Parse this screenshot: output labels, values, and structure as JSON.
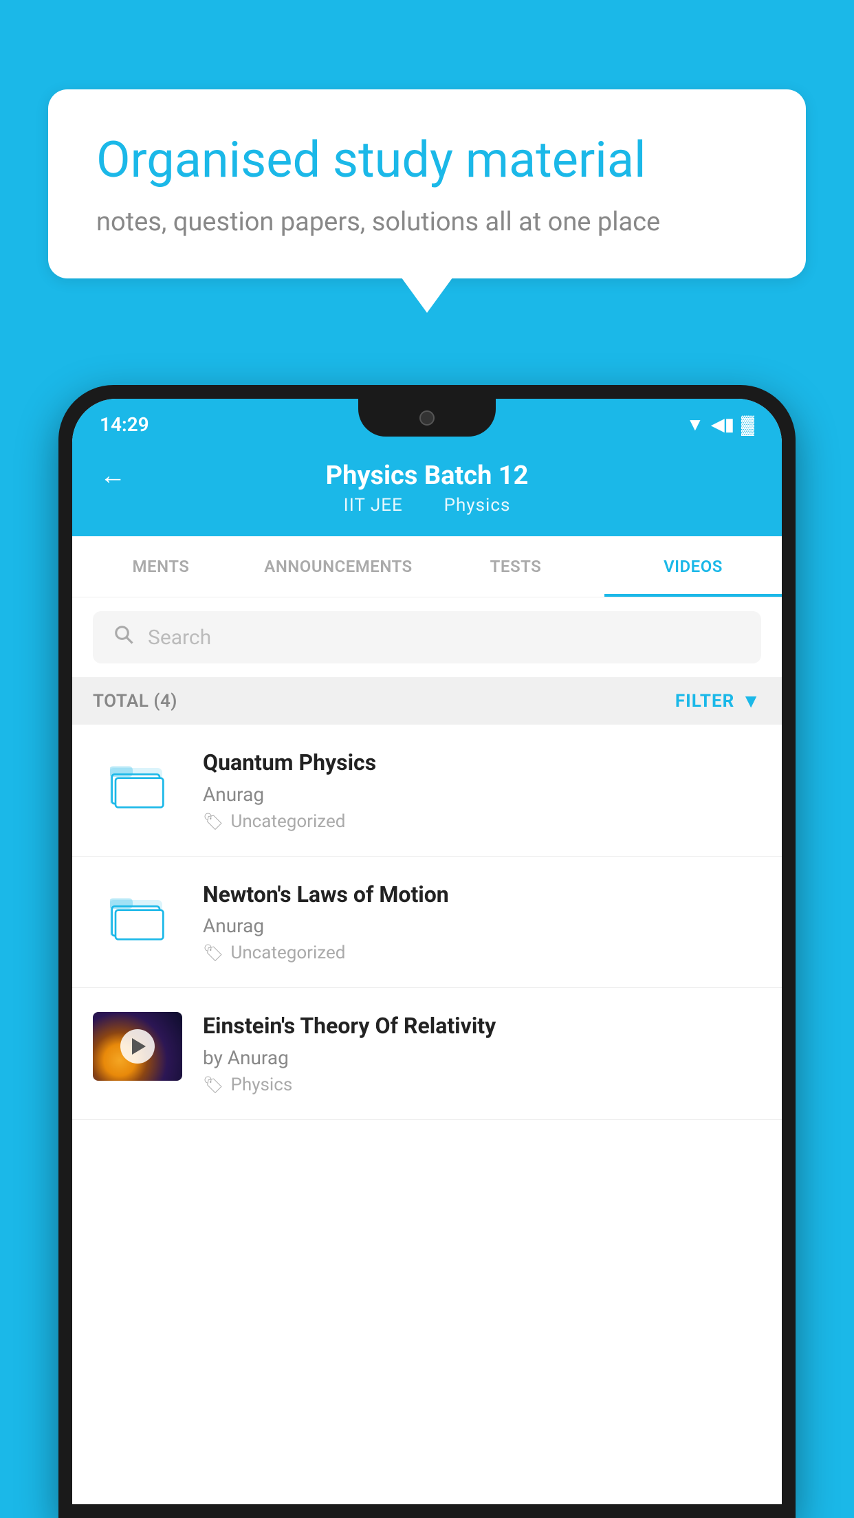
{
  "background_color": "#1BB8E8",
  "speech_bubble": {
    "title": "Organised study material",
    "subtitle": "notes, question papers, solutions all at one place"
  },
  "status_bar": {
    "time": "14:29",
    "wifi": "▼",
    "signal": "▲",
    "battery": "▌"
  },
  "header": {
    "back_label": "←",
    "title": "Physics Batch 12",
    "subtitle_part1": "IIT JEE",
    "subtitle_part2": "Physics"
  },
  "tabs": [
    {
      "label": "MENTS",
      "active": false
    },
    {
      "label": "ANNOUNCEMENTS",
      "active": false
    },
    {
      "label": "TESTS",
      "active": false
    },
    {
      "label": "VIDEOS",
      "active": true
    }
  ],
  "search": {
    "placeholder": "Search"
  },
  "filter_row": {
    "total_label": "TOTAL (4)",
    "filter_label": "FILTER"
  },
  "videos": [
    {
      "id": 1,
      "title": "Quantum Physics",
      "author": "Anurag",
      "tag": "Uncategorized",
      "has_thumbnail": false
    },
    {
      "id": 2,
      "title": "Newton's Laws of Motion",
      "author": "Anurag",
      "tag": "Uncategorized",
      "has_thumbnail": false
    },
    {
      "id": 3,
      "title": "Einstein's Theory Of Relativity",
      "author": "by Anurag",
      "tag": "Physics",
      "has_thumbnail": true
    }
  ]
}
